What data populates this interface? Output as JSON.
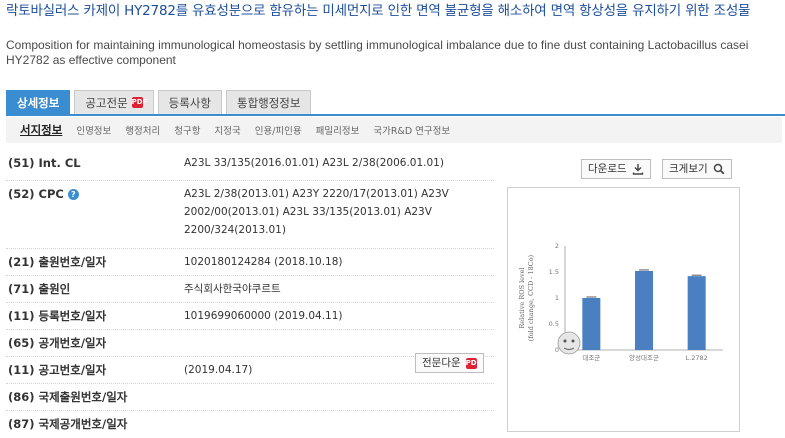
{
  "title": "락토바실러스 카제이 HY2782를 유효성분으로 함유하는 미세먼지로 인한 면역 불균형을 해소하여 면역 항상성을 유지하기 위한 조성물",
  "subtitle": "Composition for maintaining immunological homeostasis by settling immunological imbalance due to fine dust containing Lactobacillus casei HY2782 as effective component",
  "tabs": [
    {
      "label": "상세정보"
    },
    {
      "label": "공고전문"
    },
    {
      "label": "등록사항"
    },
    {
      "label": "통합행정정보"
    }
  ],
  "subtabs": [
    {
      "label": "서지정보"
    },
    {
      "label": "인명정보"
    },
    {
      "label": "행정처리"
    },
    {
      "label": "청구항"
    },
    {
      "label": "지정국"
    },
    {
      "label": "인용/피인용"
    },
    {
      "label": "패밀리정보"
    },
    {
      "label": "국가R&D 연구정보"
    }
  ],
  "fields": [
    {
      "label": "(51) Int. CL",
      "value": "A23L 33/135(2016.01.01) A23L 2/38(2006.01.01)"
    },
    {
      "label": "(52) CPC",
      "value_lines": [
        "A23L 2/38(2013.01) A23Y 2220/17(2013.01) A23V",
        "2002/00(2013.01) A23L 33/135(2013.01) A23V",
        "2200/324(2013.01)"
      ]
    },
    {
      "label": "(21) 출원번호/일자",
      "value": "1020180124284 (2018.10.18)"
    },
    {
      "label": "(71) 출원인",
      "value": "주식회사한국야쿠르트"
    },
    {
      "label": "(11) 등록번호/일자",
      "value": "1019699060000 (2019.04.11)"
    },
    {
      "label": "(65) 공개번호/일자",
      "value": ""
    },
    {
      "label": "(11) 공고번호/일자",
      "value": "(2019.04.17)"
    },
    {
      "label": "(86) 국제출원번호/일자",
      "value": ""
    },
    {
      "label": "(87) 국제공개번호/일자",
      "value": ""
    }
  ],
  "buttons": {
    "download": "다운로드",
    "zoom": "크게보기",
    "fulltext": "전문다운"
  },
  "icons": {
    "pdf": "PDF",
    "help": "?"
  },
  "colors": {
    "accent": "#3a8dd0",
    "title": "#1e4f9c",
    "bar": "#4a7fc1"
  },
  "chart_data": {
    "type": "bar",
    "categories": [
      "대조군",
      "양성대조군",
      "L.2782"
    ],
    "values": [
      1.0,
      1.52,
      1.42
    ],
    "ylabel_lines": [
      "Relative ROS level",
      "(fold change, CCD - 18Co)"
    ],
    "ylim": [
      0,
      2
    ],
    "yticks": [
      "0",
      "0.5",
      "1",
      "1.5",
      "2"
    ],
    "grid": false
  }
}
